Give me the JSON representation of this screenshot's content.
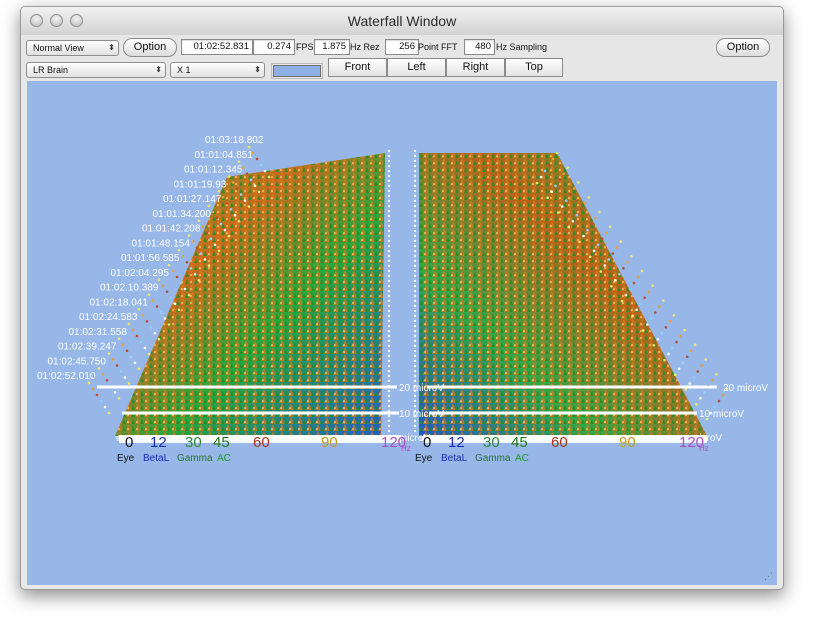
{
  "window": {
    "title": "Waterfall Window"
  },
  "toolbar": {
    "view_mode": "Normal View",
    "option_left_label": "Option",
    "option_right_label": "Option",
    "time_value": "01:02:52.831",
    "fps_value": "0.274",
    "fps_label": "FPS",
    "hz_rez_value": "1.875",
    "hz_rez_label": "Hz Rez",
    "fft_value": "256",
    "fft_label": "Point FFT",
    "sampling_value": "480",
    "sampling_label": "Hz Sampling",
    "montage": "LR Brain",
    "zoom": "X 1",
    "color_swatch": "#8fb0e6",
    "view_buttons": [
      "Front",
      "Left",
      "Right",
      "Top"
    ]
  },
  "plot": {
    "background": "#97b7e8",
    "timestamps": [
      "01:03:18.802",
      "01:01:04.851",
      "01:01:12.345",
      "01:01:19.93",
      "01:01:27.147",
      "01:01:34.200",
      "01:01:42.208",
      "01:01:48.154",
      "01:01:56.585",
      "01:02:04.295",
      "01:02:10.389",
      "01:02:18.041",
      "01:02:24.583",
      "01:02:31.558",
      "01:02:39.247",
      "01:02:45.750",
      "01:02:52.010"
    ],
    "levels": {
      "left": [
        "20 microV",
        "10 microV",
        "microV"
      ],
      "right": [
        "20 microV",
        "10 microV",
        "microV"
      ]
    },
    "freq_ticks": [
      {
        "label": "0",
        "color": "#111111"
      },
      {
        "label": "12",
        "color": "#1a2fb0"
      },
      {
        "label": "30",
        "color": "#2e8a3c"
      },
      {
        "label": "45",
        "color": "#1f7a1f"
      },
      {
        "label": "60",
        "color": "#b0341c"
      },
      {
        "label": "90",
        "color": "#c79a1a"
      },
      {
        "label": "120",
        "color": "#b04fc4"
      }
    ],
    "hz_unit": "Hz",
    "bands": [
      {
        "label": "Eye",
        "color": "#111111"
      },
      {
        "label": "BetaL",
        "color": "#1a2fb0"
      },
      {
        "label": "Gamma",
        "color": "#2e6e3a"
      },
      {
        "label": "AC",
        "color": "#1f9a2f"
      }
    ]
  }
}
